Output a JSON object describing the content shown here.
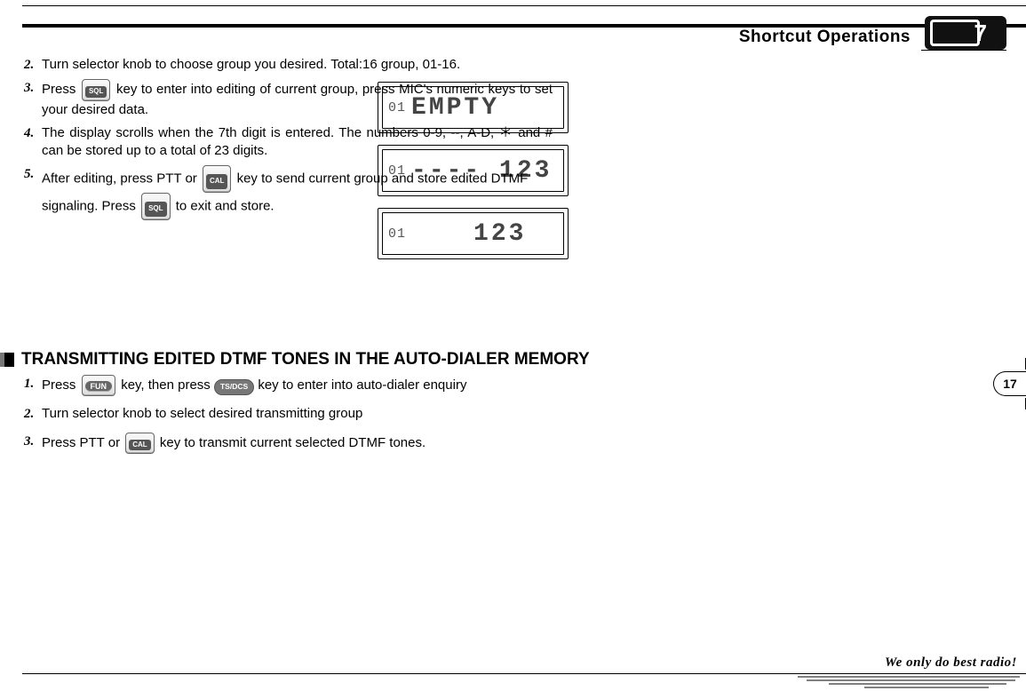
{
  "header": {
    "title": "Shortcut Operations",
    "chapter": "7"
  },
  "page_number": "17",
  "keys": {
    "sql": "SQL",
    "cal": "CAL",
    "fun": "FUN",
    "tsdcs": "TS/DCS"
  },
  "lcd": {
    "d1_small": "01",
    "d1_big": "EMPTY",
    "d2_small": "01",
    "d2_big": "---- 123",
    "d3_small": "01",
    "d3_big": "123"
  },
  "steps_a": {
    "n2": "2.",
    "t2": "Turn selector knob to choose group you desired. Total:16 group, 01-16.",
    "n3": "3.",
    "t3a": "Press ",
    "t3b": " key to enter into editing of current group, press MIC's numeric keys to set your desired data.",
    "n4": "4.",
    "t4": "The display scrolls when the 7th digit is entered. The numbers 0-9, --, A-D, ＊ and # can be stored up to a total of 23 digits.",
    "n5": "5.",
    "t5a": "After editing, press PTT or ",
    "t5b": " key to send current group and store edited DTMF signaling. Press ",
    "t5c": " to exit and store."
  },
  "section_heading": "TRANSMITTING EDITED DTMF TONES IN THE AUTO-DIALER MEMORY",
  "steps_b": {
    "n1": "1.",
    "t1a": "Press ",
    "t1b": " key, then press ",
    "t1c": " key to enter into auto-dialer enquiry",
    "n2": "2.",
    "t2": "Turn selector knob to select desired transmitting group",
    "n3": "3.",
    "t3a": "Press PTT or ",
    "t3b": " key to transmit current selected DTMF tones."
  },
  "footer": {
    "slogan": "We only do best radio!"
  }
}
